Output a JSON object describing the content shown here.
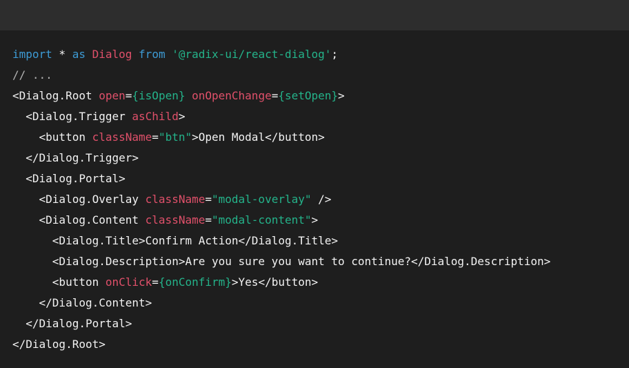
{
  "editor": {
    "lines": [
      [
        {
          "type": "kw",
          "text": "import"
        },
        {
          "type": "plain",
          "text": " * "
        },
        {
          "type": "kw",
          "text": "as"
        },
        {
          "type": "plain",
          "text": " "
        },
        {
          "type": "id",
          "text": "Dialog"
        },
        {
          "type": "plain",
          "text": " "
        },
        {
          "type": "kw",
          "text": "from"
        },
        {
          "type": "plain",
          "text": " "
        },
        {
          "type": "str",
          "text": "'@radix-ui/react-dialog'"
        },
        {
          "type": "plain",
          "text": ";"
        }
      ],
      [
        {
          "type": "com",
          "text": "// ..."
        }
      ],
      [
        {
          "type": "plain",
          "text": "<Dialog.Root "
        },
        {
          "type": "attr",
          "text": "open"
        },
        {
          "type": "plain",
          "text": "="
        },
        {
          "type": "val",
          "text": "{isOpen}"
        },
        {
          "type": "plain",
          "text": " "
        },
        {
          "type": "attr",
          "text": "onOpenChange"
        },
        {
          "type": "plain",
          "text": "="
        },
        {
          "type": "val",
          "text": "{setOpen}"
        },
        {
          "type": "plain",
          "text": ">"
        }
      ],
      [
        {
          "type": "plain",
          "text": "  <Dialog.Trigger "
        },
        {
          "type": "attr",
          "text": "asChild"
        },
        {
          "type": "plain",
          "text": ">"
        }
      ],
      [
        {
          "type": "plain",
          "text": "    <button "
        },
        {
          "type": "attr",
          "text": "className"
        },
        {
          "type": "plain",
          "text": "="
        },
        {
          "type": "val",
          "text": "\"btn\""
        },
        {
          "type": "plain",
          "text": ">Open Modal</button>"
        }
      ],
      [
        {
          "type": "plain",
          "text": "  </Dialog.Trigger>"
        }
      ],
      [
        {
          "type": "plain",
          "text": "  <Dialog.Portal>"
        }
      ],
      [
        {
          "type": "plain",
          "text": "    <Dialog.Overlay "
        },
        {
          "type": "attr",
          "text": "className"
        },
        {
          "type": "plain",
          "text": "="
        },
        {
          "type": "val",
          "text": "\"modal-overlay\""
        },
        {
          "type": "plain",
          "text": " />"
        }
      ],
      [
        {
          "type": "plain",
          "text": "    <Dialog.Content "
        },
        {
          "type": "attr",
          "text": "className"
        },
        {
          "type": "plain",
          "text": "="
        },
        {
          "type": "val",
          "text": "\"modal-content\""
        },
        {
          "type": "plain",
          "text": ">"
        }
      ],
      [
        {
          "type": "plain",
          "text": "      <Dialog.Title>Confirm Action</Dialog.Title>"
        }
      ],
      [
        {
          "type": "plain",
          "text": "      <Dialog.Description>Are you sure you want to continue?</Dialog.Description>"
        }
      ],
      [
        {
          "type": "plain",
          "text": "      <button "
        },
        {
          "type": "attr",
          "text": "onClick"
        },
        {
          "type": "plain",
          "text": "="
        },
        {
          "type": "val",
          "text": "{onConfirm}"
        },
        {
          "type": "plain",
          "text": ">Yes</button>"
        }
      ],
      [
        {
          "type": "plain",
          "text": "    </Dialog.Content>"
        }
      ],
      [
        {
          "type": "plain",
          "text": "  </Dialog.Portal>"
        }
      ],
      [
        {
          "type": "plain",
          "text": "</Dialog.Root>"
        }
      ]
    ]
  },
  "colors": {
    "background": "#1e1e1e",
    "topbar": "#2d2d2d",
    "keyword": "#3d9bd5",
    "identifier": "#e0506a",
    "string": "#24b38a",
    "comment": "#b3b3b3",
    "plain": "#f2f2f2"
  }
}
